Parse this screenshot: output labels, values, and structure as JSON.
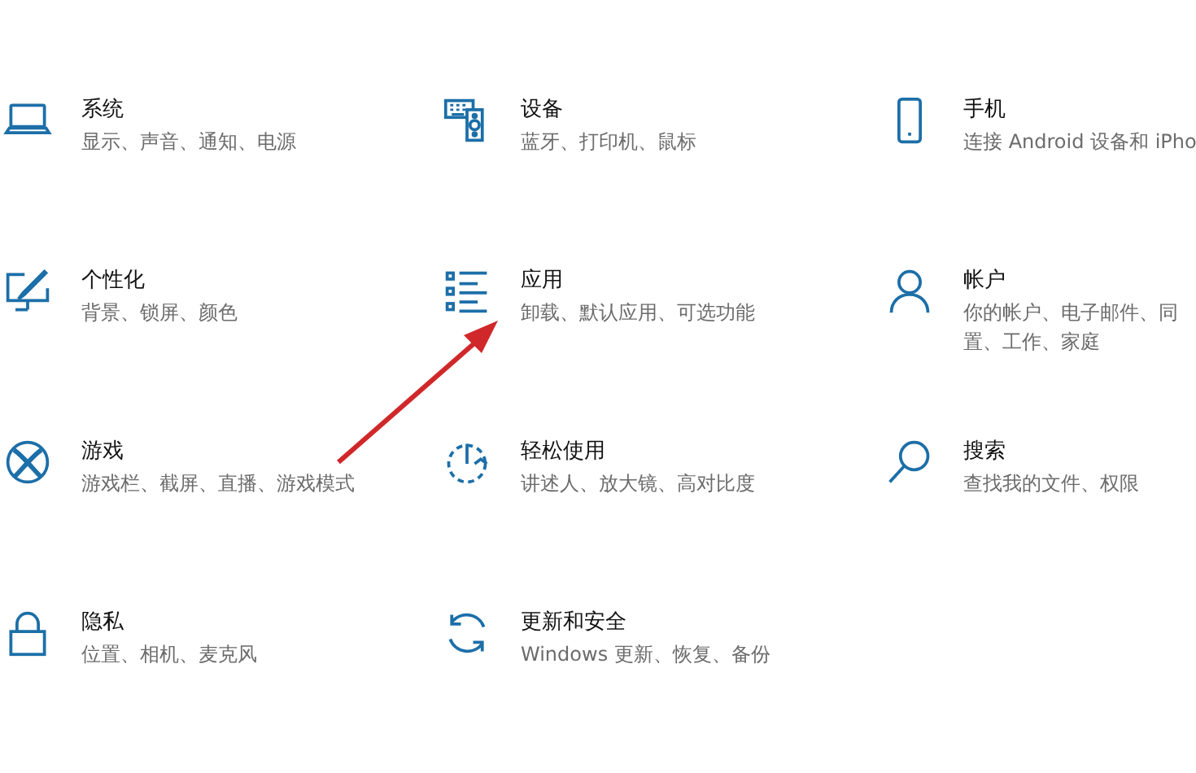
{
  "settings": [
    {
      "title": "系统",
      "description": [
        "显示、声音、通知、电源"
      ]
    },
    {
      "title": "设备",
      "description": [
        "蓝牙、打印机、鼠标"
      ]
    },
    {
      "title": "手机",
      "description": [
        "连接 Android 设备和 iPho"
      ]
    },
    {
      "title": "个性化",
      "description": [
        "背景、锁屏、颜色"
      ]
    },
    {
      "title": "应用",
      "description": [
        "卸载、默认应用、可选功能"
      ]
    },
    {
      "title": "帐户",
      "description": [
        "你的帐户、电子邮件、同",
        "置、工作、家庭"
      ]
    },
    {
      "title": "游戏",
      "description": [
        "游戏栏、截屏、直播、游戏模式"
      ]
    },
    {
      "title": "轻松使用",
      "description": [
        "讲述人、放大镜、高对比度"
      ]
    },
    {
      "title": "搜索",
      "description": [
        "查找我的文件、权限"
      ]
    },
    {
      "title": "隐私",
      "description": [
        "位置、相机、麦克风"
      ]
    },
    {
      "title": "更新和安全",
      "description": [
        "Windows 更新、恢复、备份"
      ]
    }
  ]
}
